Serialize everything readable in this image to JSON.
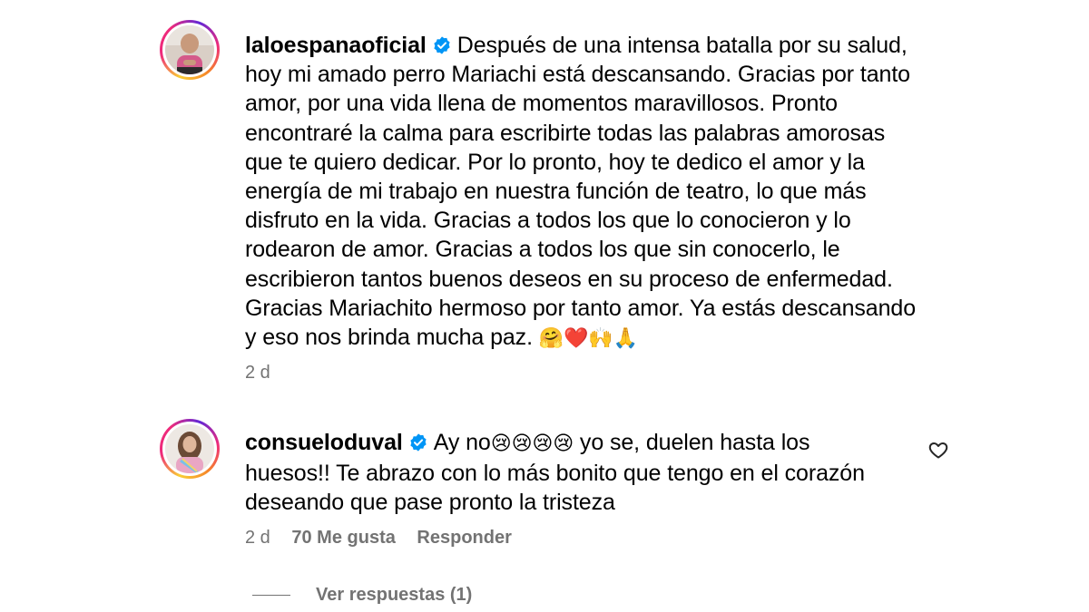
{
  "post": {
    "username": "laloespanaoficial",
    "verified_icon": "verified-badge-icon",
    "text": "Después de una intensa batalla por su salud, hoy mi amado perro Mariachi está descansando. Gracias por tanto amor, por una vida llena de momentos maravillosos. Pronto encontraré la calma para escribirte todas las palabras amorosas que te quiero dedicar. Por lo pronto, hoy te dedico el amor y la energía de mi trabajo en nuestra función de teatro, lo que más disfruto en la vida. Gracias a todos los que lo conocieron y lo rodearon de amor. Gracias a todos los que sin conocerlo, le escribieron tantos buenos deseos en su proceso de enfermedad. Gracias Mariachito hermoso por tanto amor. Ya estás descansando y eso nos brinda mucha paz.",
    "emojis": "🤗❤️🙌🙏",
    "time": "2 d"
  },
  "reply": {
    "username": "consueloduval",
    "verified_icon": "verified-badge-icon",
    "text_start": "Ay no",
    "emojis": "😢😢😢😢",
    "text_end": " yo se, duelen hasta los huesos!! Te abrazo con lo más bonito que tengo en el corazón deseando que pase pronto la tristeza",
    "time": "2 d",
    "likes": "70 Me gusta",
    "reply_label": "Responder",
    "like_icon": "heart-outline-icon"
  },
  "view_replies": "Ver respuestas (1)",
  "colors": {
    "verified": "#0095f6",
    "secondary_text": "#737373",
    "primary_text": "#000000"
  }
}
